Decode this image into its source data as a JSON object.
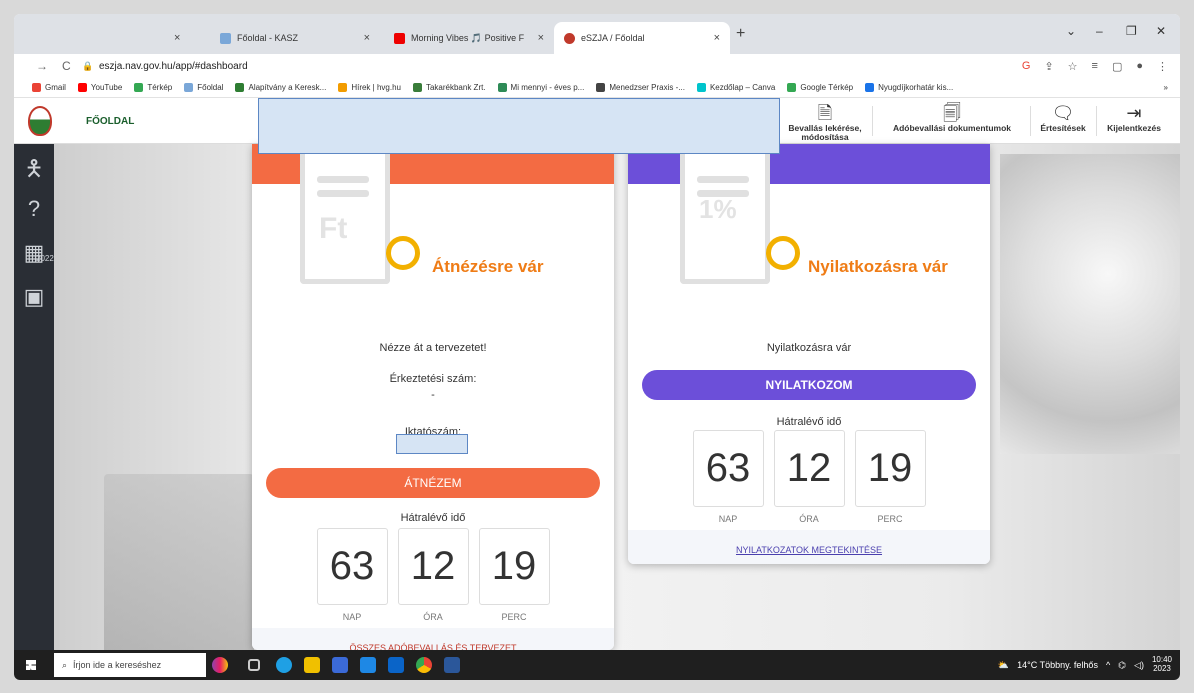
{
  "browser": {
    "tabs": [
      {
        "label": "Főoldal - KASZ"
      },
      {
        "label": "Morning Vibes 🎵 Positive F"
      },
      {
        "label": "eSZJA / Főoldal"
      }
    ],
    "url": "eszja.nav.gov.hu/app/#dashboard",
    "bookmarks": [
      "Gmail",
      "YouTube",
      "Térkép",
      "Főoldal",
      "Alapítvány a Keresk...",
      "Hírek | hvg.hu",
      "Takarékbank Zrt.",
      "Mi mennyi - éves p...",
      "Menedzser Praxis -...",
      "Kezdőlap – Canva",
      "Google Térkép",
      "Nyugdíjkorhatár kis..."
    ],
    "bookmark_colors": [
      "#ea4335",
      "#ff0000",
      "#34a853",
      "#7aa7d8",
      "#2e7d32",
      "#f29c00",
      "#3a7d3a",
      "#2e8b57",
      "#444444",
      "#00c4cc",
      "#34a853",
      "#1a73e8"
    ],
    "more": "»"
  },
  "header": {
    "home": "FŐOLDAL",
    "nav": [
      {
        "label": "Bevallás lekérése, módosítása"
      },
      {
        "label": "Adóbevallási dokumentumok"
      },
      {
        "label": "Értesítések"
      },
      {
        "label": "Kijelentkezés"
      }
    ]
  },
  "sidebar": {
    "year": "2022"
  },
  "card1": {
    "doc_symbol": "Ft",
    "status": "Átnézésre vár",
    "message": "Nézze át a tervezetet!",
    "arrival_label": "Érkeztetési szám:",
    "arrival_value": "-",
    "file_label": "Iktatószám:",
    "button": "ÁTNÉZEM",
    "remaining_label": "Hátralévő idő",
    "days": "63",
    "hours": "12",
    "minutes": "19",
    "unit_days": "NAP",
    "unit_hours": "ÓRA",
    "unit_minutes": "PERC",
    "footer": "ÖSSZES ADÓBEVALLÁS ÉS TERVEZET"
  },
  "card2": {
    "doc_symbol": "1%",
    "status": "Nyilatkozásra vár",
    "message": "Nyilatkozásra vár",
    "button": "NYILATKOZOM",
    "remaining_label": "Hátralévő idő",
    "days": "63",
    "hours": "12",
    "minutes": "19",
    "unit_days": "NAP",
    "unit_hours": "ÓRA",
    "unit_minutes": "PERC",
    "footer": "NYILATKOZATOK MEGTEKINTÉSE"
  },
  "taskbar": {
    "search_placeholder": "Írjon ide a kereséshez",
    "weather": "14°C Többny. felhős",
    "time": "10:40",
    "date": "2023"
  }
}
